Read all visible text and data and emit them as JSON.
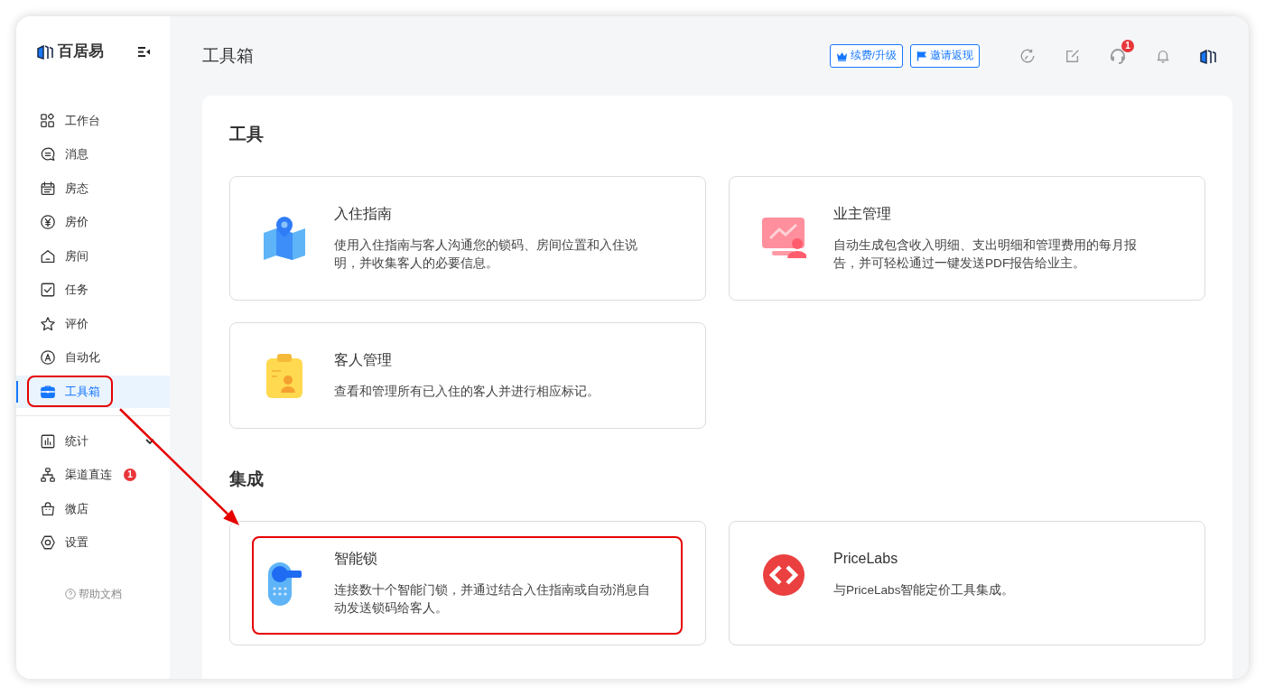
{
  "sidebar": {
    "logo_text": "百居易",
    "sections": [
      {
        "items": [
          {
            "label": "工作台",
            "kind": "link",
            "selected": false,
            "highlighted": false
          },
          {
            "label": "消息",
            "kind": "link",
            "selected": false,
            "highlighted": false
          },
          {
            "label": "房态",
            "kind": "link",
            "selected": false,
            "highlighted": false
          },
          {
            "label": "房价",
            "kind": "link",
            "selected": false,
            "highlighted": false
          },
          {
            "label": "房间",
            "kind": "link",
            "selected": false,
            "highlighted": false
          },
          {
            "label": "任务",
            "kind": "link",
            "selected": false,
            "highlighted": false
          },
          {
            "label": "评价",
            "kind": "link",
            "selected": false,
            "highlighted": false
          },
          {
            "label": "自动化",
            "kind": "link",
            "selected": false,
            "highlighted": false
          },
          {
            "label": "工具箱",
            "kind": "link",
            "selected": true,
            "highlighted": true
          }
        ]
      },
      {
        "items": [
          {
            "label": "统计",
            "kind": "group",
            "expanded": false,
            "selected": false,
            "highlighted": false
          },
          {
            "label": "渠道直连",
            "kind": "link",
            "badge": "1",
            "selected": false,
            "highlighted": false
          },
          {
            "label": "微店",
            "kind": "link",
            "selected": false,
            "highlighted": false
          },
          {
            "label": "设置",
            "kind": "link",
            "selected": false,
            "highlighted": false
          }
        ]
      }
    ],
    "help": "帮助文档"
  },
  "header": {
    "title": "工具箱",
    "buttons": [
      "续费/升级",
      "邀请返现"
    ],
    "support_badge": "1"
  },
  "sections": [
    {
      "title": "工具",
      "cards": [
        {
          "title": "入住指南",
          "description": "使用入住指南与客人沟通您的锁码、房间位置和入住说明，并收集客人的必要信息。",
          "highlighted": false
        },
        {
          "title": "业主管理",
          "description": "自动生成包含收入明细、支出明细和管理费用的每月报告，并可轻松通过一键发送PDF报告给业主。",
          "highlighted": false
        },
        {
          "title": "客人管理",
          "description": "查看和管理所有已入住的客人并进行相应标记。",
          "highlighted": false
        }
      ]
    },
    {
      "title": "集成",
      "cards": [
        {
          "title": "智能锁",
          "description": "连接数十个智能门锁，并通过结合入住指南或自动消息自动发送锁码给客人。",
          "highlighted": true
        },
        {
          "title": "PriceLabs",
          "description": "与PriceLabs智能定价工具集成。",
          "highlighted": false
        }
      ]
    }
  ],
  "annotation": {
    "arrow": true
  }
}
